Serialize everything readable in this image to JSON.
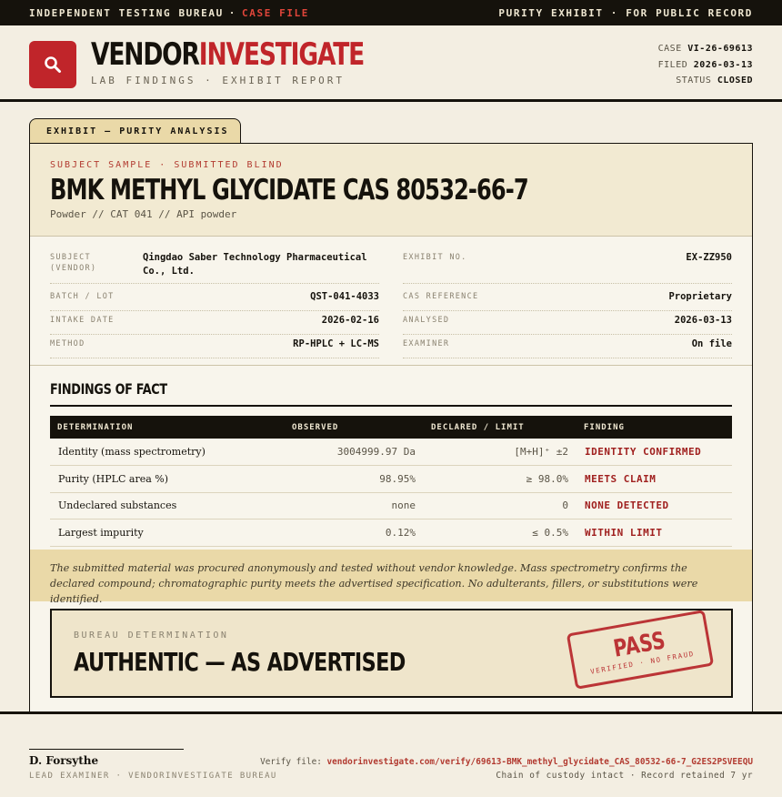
{
  "topbar": {
    "left_prefix": "INDEPENDENT TESTING BUREAU",
    "separator": "·",
    "left_accent": "CASE FILE",
    "right": "PURITY EXHIBIT · FOR PUBLIC RECORD"
  },
  "header": {
    "brand_part1": "VENDOR",
    "brand_part2": "INVESTIGATE",
    "tagline": "LAB FINDINGS · EXHIBIT REPORT",
    "logo_icon": "magnifier-icon",
    "case_label": "CASE",
    "case_value": "VI-26-69613",
    "filed_label": "FILED",
    "filed_value": "2026-03-13",
    "status_label": "STATUS",
    "status_value": "CLOSED"
  },
  "exhibit": {
    "tab_label": "EXHIBIT — PURITY ANALYSIS",
    "kicker": "SUBJECT SAMPLE · SUBMITTED BLIND",
    "title": "BMK METHYL GLYCIDATE CAS 80532-66-7",
    "subline": "Powder  //  CAT 041  //  API powder"
  },
  "meta": {
    "left": [
      {
        "key": "SUBJECT (VENDOR)",
        "value": "Qingdao Saber Technology Pharmaceutical Co., Ltd."
      },
      {
        "key": "BATCH / LOT",
        "value": "QST-041-4033"
      },
      {
        "key": "INTAKE DATE",
        "value": "2026-02-16"
      },
      {
        "key": "METHOD",
        "value": "RP-HPLC + LC-MS"
      }
    ],
    "right": [
      {
        "key": "EXHIBIT NO.",
        "value": "EX-ZZ950"
      },
      {
        "key": "CAS REFERENCE",
        "value": "Proprietary"
      },
      {
        "key": "ANALYSED",
        "value": "2026-03-13"
      },
      {
        "key": "EXAMINER",
        "value": "On file"
      }
    ]
  },
  "findings": {
    "title": "FINDINGS OF FACT",
    "headers": [
      "DETERMINATION",
      "OBSERVED",
      "DECLARED / LIMIT",
      "FINDING"
    ],
    "rows": [
      {
        "determination": "Identity (mass spectrometry)",
        "observed": "3004999.97 Da",
        "limit": "[M+H]⁺ ±2",
        "finding": "IDENTITY CONFIRMED"
      },
      {
        "determination": "Purity (HPLC area %)",
        "observed": "98.95%",
        "limit": "≥ 98.0%",
        "finding": "MEETS CLAIM"
      },
      {
        "determination": "Undeclared substances",
        "observed": "none",
        "limit": "0",
        "finding": "NONE DETECTED"
      },
      {
        "determination": "Largest impurity",
        "observed": "0.12%",
        "limit": "≤ 0.5%",
        "finding": "WITHIN LIMIT"
      }
    ]
  },
  "narrative": "The submitted material was procured anonymously and tested without vendor knowledge. Mass spectrometry confirms the declared compound; chromatographic purity meets the advertised specification. No adulterants, fillers, or substitutions were identified.",
  "verdict": {
    "kicker": "BUREAU DETERMINATION",
    "title": "AUTHENTIC — AS ADVERTISED",
    "stamp_main": "PASS",
    "stamp_sub": "VERIFIED · NO FRAUD"
  },
  "footer": {
    "examiner_name": "D. Forsythe",
    "examiner_role": "LEAD EXAMINER · VENDORINVESTIGATE BUREAU",
    "verify_label": "Verify file:",
    "verify_link": "vendorinvestigate.com/verify/69613-BMK_methyl_glycidate_CAS_80532-66-7_G2ES2PSVEEQU",
    "custody": "Chain of custody intact · Record retained 7 yr"
  },
  "colors": {
    "accent": "#c0252a",
    "ink": "#15120c",
    "paper": "#f3eee2",
    "highlight": "#ead9a8"
  }
}
